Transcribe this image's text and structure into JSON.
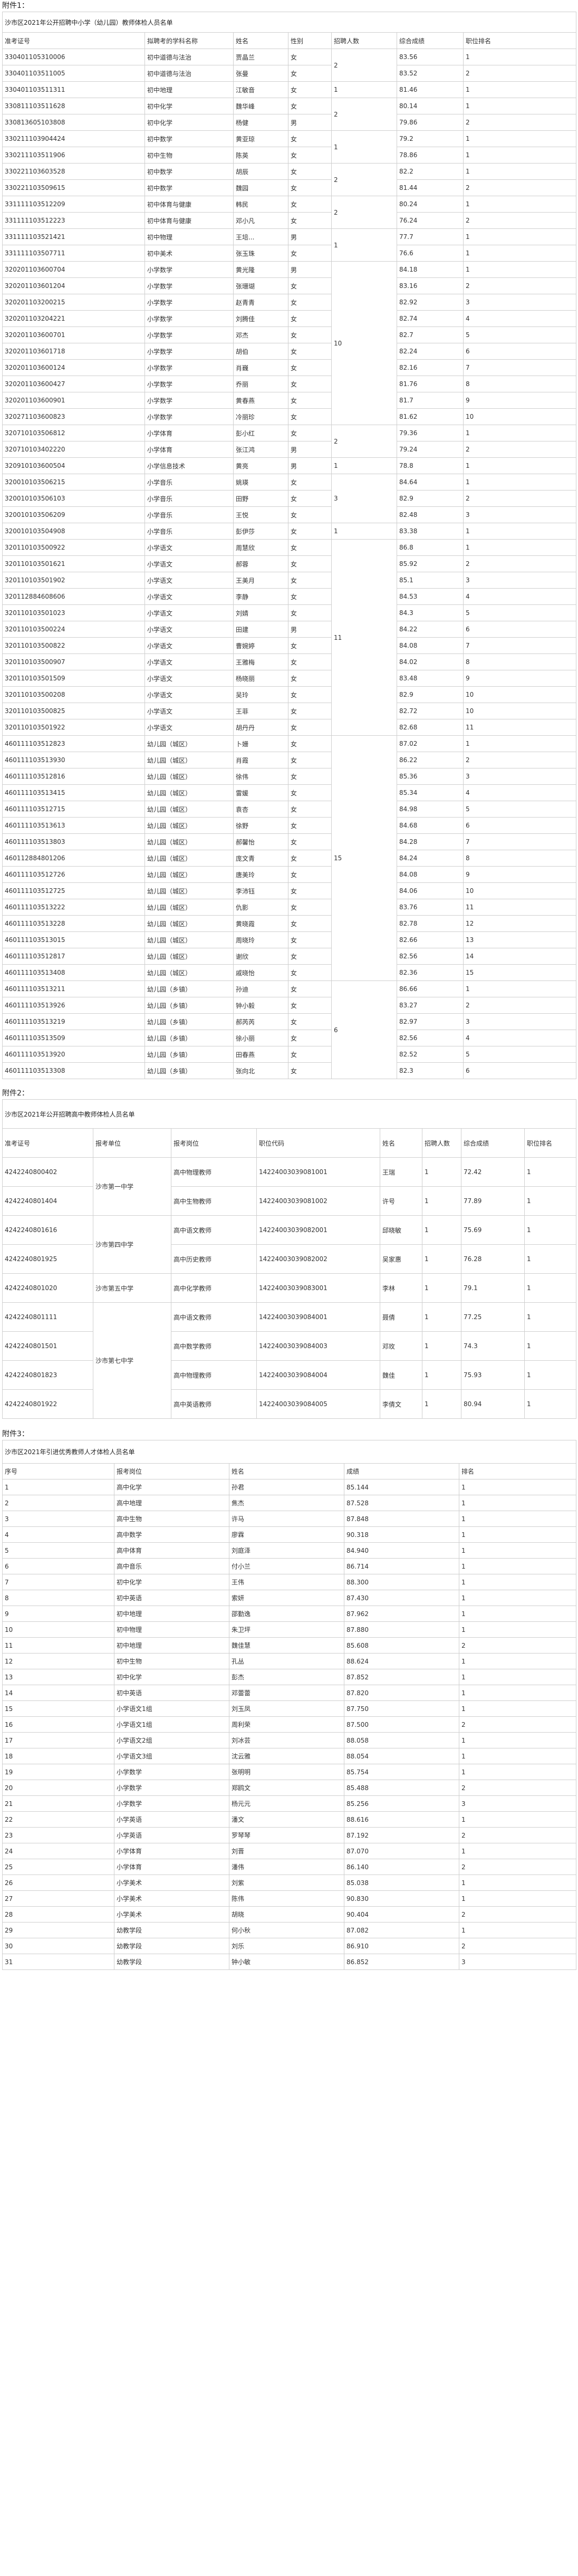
{
  "attachment1": {
    "label": "附件1：",
    "title": "沙市区2021年公开招聘中小学（幼儿园）教师体检人员名单",
    "headers": [
      "准考证号",
      "拟聘考的学科名称",
      "姓名",
      "性别",
      "招聘人数",
      "综合成绩",
      "职位排名"
    ],
    "rows": [
      [
        "330401105310006",
        "初中道德与法治",
        "贾晶兰",
        "女",
        "",
        "83.56",
        "1"
      ],
      [
        "330401103511005",
        "初中道德与法治",
        "张曼",
        "女",
        "",
        "83.52",
        "2"
      ],
      [
        "330401103511311",
        "初中地理",
        "江敏音",
        "女",
        "",
        "81.46",
        "1"
      ],
      [
        "330811103511628",
        "初中化学",
        "魏华峰",
        "女",
        "",
        "80.14",
        "1"
      ],
      [
        "330813605103808",
        "初中化学",
        "杨健",
        "男",
        "",
        "79.86",
        "2"
      ],
      [
        "330211103904424",
        "初中数学",
        "黄亚琼",
        "女",
        "",
        "79.2",
        "1"
      ],
      [
        "330211103511906",
        "初中生物",
        "陈英",
        "女",
        "",
        "78.86",
        "1"
      ],
      [
        "330221103603528",
        "初中数学",
        "胡辰",
        "女",
        "",
        "82.2",
        "1"
      ],
      [
        "330221103509615",
        "初中数学",
        "魏园",
        "女",
        "",
        "81.44",
        "2"
      ],
      [
        "331111103512209",
        "初中体育与健康",
        "韩民",
        "女",
        "",
        "80.24",
        "1"
      ],
      [
        "331111103512223",
        "初中体育与健康",
        "邓小凡",
        "女",
        "",
        "76.24",
        "2"
      ],
      [
        "331111103521421",
        "初中物理",
        "王培...",
        "男",
        "",
        "77.7",
        "1"
      ],
      [
        "331111103507711",
        "初中美术",
        "张玉珠",
        "女",
        "",
        "76.6",
        "1"
      ],
      [
        "320201103600704",
        "小学数学",
        "黄光隆",
        "男",
        "",
        "84.18",
        "1"
      ],
      [
        "320201103601204",
        "小学数学",
        "张珊瑚",
        "女",
        "",
        "83.16",
        "2"
      ],
      [
        "320201103200215",
        "小学数学",
        "赵青青",
        "女",
        "",
        "82.92",
        "3"
      ],
      [
        "320201103204221",
        "小学数学",
        "刘腾佳",
        "女",
        "",
        "82.74",
        "4"
      ],
      [
        "320201103600701",
        "小学数学",
        "邓杰",
        "女",
        "",
        "82.7",
        "5"
      ],
      [
        "320201103601718",
        "小学数学",
        "胡伯",
        "女",
        "",
        "82.24",
        "6"
      ],
      [
        "320201103600124",
        "小学数学",
        "肖巍",
        "女",
        "",
        "82.16",
        "7"
      ],
      [
        "320201103600427",
        "小学数学",
        "乔丽",
        "女",
        "",
        "81.76",
        "8"
      ],
      [
        "320201103600901",
        "小学数学",
        "黄春燕",
        "女",
        "",
        "81.7",
        "9"
      ],
      [
        "320271103600823",
        "小学数学",
        "冷丽珍",
        "女",
        "",
        "81.62",
        "10"
      ],
      [
        "320710103506812",
        "小学体育",
        "彭小红",
        "女",
        "",
        "79.36",
        "1"
      ],
      [
        "320710103402220",
        "小学体育",
        "张江鸿",
        "男",
        "",
        "79.24",
        "2"
      ],
      [
        "320910103600504",
        "小学信息技术",
        "黄亮",
        "男",
        "",
        "78.8",
        "1"
      ],
      [
        "320010103506215",
        "小学音乐",
        "姚瑛",
        "女",
        "",
        "84.64",
        "1"
      ],
      [
        "320010103506103",
        "小学音乐",
        "田野",
        "女",
        "",
        "82.9",
        "2"
      ],
      [
        "320010103506209",
        "小学音乐",
        "王悦",
        "女",
        "",
        "82.48",
        "3"
      ],
      [
        "320010103504908",
        "小学音乐",
        "彭伊莎",
        "女",
        "",
        "83.38",
        "1"
      ],
      [
        "320110103500922",
        "小学语文",
        "周慧欣",
        "女",
        "",
        "86.8",
        "1"
      ],
      [
        "320110103501621",
        "小学语文",
        "郝蓉",
        "女",
        "",
        "85.92",
        "2"
      ],
      [
        "320110103501902",
        "小学语文",
        "王美月",
        "女",
        "",
        "85.1",
        "3"
      ],
      [
        "320112884608606",
        "小学语文",
        "李静",
        "女",
        "",
        "84.53",
        "4"
      ],
      [
        "320110103501023",
        "小学语文",
        "刘婧",
        "女",
        "",
        "84.3",
        "5"
      ],
      [
        "320110103500224",
        "小学语文",
        "田建",
        "男",
        "",
        "84.22",
        "6"
      ],
      [
        "320110103500822",
        "小学语文",
        "曹婉婷",
        "女",
        "",
        "84.08",
        "7"
      ],
      [
        "320110103500907",
        "小学语文",
        "王雅梅",
        "女",
        "",
        "84.02",
        "8"
      ],
      [
        "320110103501509",
        "小学语文",
        "杨晓丽",
        "女",
        "",
        "83.48",
        "9"
      ],
      [
        "320110103500208",
        "小学语文",
        "吴玲",
        "女",
        "",
        "82.9",
        "10"
      ],
      [
        "320110103500825",
        "小学语文",
        "王菲",
        "女",
        "",
        "82.72",
        "10"
      ],
      [
        "320110103501922",
        "小学语文",
        "胡丹丹",
        "女",
        "",
        "82.68",
        "11"
      ],
      [
        "460111103512823",
        "幼儿园（城区）",
        "卜姗",
        "女",
        "",
        "87.02",
        "1"
      ],
      [
        "460111103513930",
        "幼儿园（城区）",
        "肖霞",
        "女",
        "",
        "86.22",
        "2"
      ],
      [
        "460111103512816",
        "幼儿园（城区）",
        "徐伟",
        "女",
        "",
        "85.36",
        "3"
      ],
      [
        "460111103513415",
        "幼儿园（城区）",
        "雷媛",
        "女",
        "",
        "85.34",
        "4"
      ],
      [
        "460111103512715",
        "幼儿园（城区）",
        "袁杏",
        "女",
        "",
        "84.98",
        "5"
      ],
      [
        "460111103513613",
        "幼儿园（城区）",
        "徐野",
        "女",
        "",
        "84.68",
        "6"
      ],
      [
        "460111103513803",
        "幼儿园（城区）",
        "郝馨怡",
        "女",
        "",
        "84.28",
        "7"
      ],
      [
        "460112884801206",
        "幼儿园（城区）",
        "庞文青",
        "女",
        "",
        "84.24",
        "8"
      ],
      [
        "460111103512726",
        "幼儿园（城区）",
        "唐美玲",
        "女",
        "",
        "84.08",
        "9"
      ],
      [
        "460111103512725",
        "幼儿园（城区）",
        "李沛钰",
        "女",
        "",
        "84.06",
        "10"
      ],
      [
        "460111103513222",
        "幼儿园（城区）",
        "仇影",
        "女",
        "",
        "83.76",
        "11"
      ],
      [
        "460111103513228",
        "幼儿园（城区）",
        "黄晓霞",
        "女",
        "",
        "82.78",
        "12"
      ],
      [
        "460111103513015",
        "幼儿园（城区）",
        "周晓玲",
        "女",
        "",
        "82.66",
        "13"
      ],
      [
        "460111103512817",
        "幼儿园（城区）",
        "谢欣",
        "女",
        "",
        "82.56",
        "14"
      ],
      [
        "460111103513408",
        "幼儿园（城区）",
        "戚晓怡",
        "女",
        "",
        "82.36",
        "15"
      ],
      [
        "460111103513211",
        "幼儿园（乡镇）",
        "孙迪",
        "女",
        "",
        "86.66",
        "1"
      ],
      [
        "460111103513926",
        "幼儿园（乡镇）",
        "钟小毅",
        "女",
        "",
        "83.27",
        "2"
      ],
      [
        "460111103513219",
        "幼儿园（乡镇）",
        "郝芮芮",
        "女",
        "",
        "82.97",
        "3"
      ],
      [
        "460111103513509",
        "幼儿园（乡镇）",
        "徐小丽",
        "女",
        "",
        "82.56",
        "4"
      ],
      [
        "460111103513920",
        "幼儿园（乡镇）",
        "田春燕",
        "女",
        "",
        "82.52",
        "5"
      ],
      [
        "460111103513308",
        "幼儿园（乡镇）",
        "张向北",
        "女",
        "",
        "82.3",
        "6"
      ]
    ],
    "quota_groups": [
      {
        "start": 0,
        "span": 2,
        "value": "2"
      },
      {
        "start": 2,
        "span": 1,
        "value": "1"
      },
      {
        "start": 3,
        "span": 2,
        "value": "2"
      },
      {
        "start": 5,
        "span": 2,
        "value": "1"
      },
      {
        "start": 7,
        "span": 2,
        "value": "2"
      },
      {
        "start": 9,
        "span": 2,
        "value": "2"
      },
      {
        "start": 11,
        "span": 2,
        "value": "1"
      },
      {
        "start": 13,
        "span": 10,
        "value": "10"
      },
      {
        "start": 23,
        "span": 2,
        "value": "2"
      },
      {
        "start": 25,
        "span": 1,
        "value": "1"
      },
      {
        "start": 26,
        "span": 3,
        "value": "3"
      },
      {
        "start": 29,
        "span": 1,
        "value": "1"
      },
      {
        "start": 30,
        "span": 12,
        "value": "11"
      },
      {
        "start": 42,
        "span": 15,
        "value": "15"
      },
      {
        "start": 57,
        "span": 6,
        "value": "6"
      }
    ]
  },
  "attachment2": {
    "label": "附件2：",
    "title": "沙市区2021年公开招聘高中教师体检人员名单",
    "headers": [
      "准考证号",
      "报考单位",
      "报考岗位",
      "职位代码",
      "姓名",
      "招聘人数",
      "综合成绩",
      "职位排名"
    ],
    "rows": [
      [
        "4242240800402",
        "",
        "高中物理教师",
        "14224003039081001",
        "王瑞",
        "1",
        "72.42",
        "1"
      ],
      [
        "4242240801404",
        "",
        "高中生物教师",
        "14224003039081002",
        "许号",
        "1",
        "77.89",
        "1"
      ],
      [
        "4242240801616",
        "",
        "高中语文教师",
        "14224003039082001",
        "邱晓敏",
        "1",
        "75.69",
        "1"
      ],
      [
        "4242240801925",
        "",
        "高中历史教师",
        "14224003039082002",
        "吴家惠",
        "1",
        "76.28",
        "1"
      ],
      [
        "4242240801020",
        "",
        "高中化学教师",
        "14224003039083001",
        "李林",
        "1",
        "79.1",
        "1"
      ],
      [
        "4242240801111",
        "",
        "高中语文教师",
        "14224003039084001",
        "聂倩",
        "1",
        "77.25",
        "1"
      ],
      [
        "4242240801501",
        "",
        "高中数学教师",
        "14224003039084003",
        "邓玫",
        "1",
        "74.3",
        "1"
      ],
      [
        "4242240801823",
        "",
        "高中物理教师",
        "14224003039084004",
        "魏佳",
        "1",
        "75.93",
        "1"
      ],
      [
        "4242240801922",
        "",
        "高中英语教师",
        "14224003039084005",
        "李倩文",
        "1",
        "80.94",
        "1"
      ]
    ],
    "unit_groups": [
      {
        "start": 0,
        "span": 2,
        "value": "沙市第一中学"
      },
      {
        "start": 2,
        "span": 2,
        "value": "沙市第四中学"
      },
      {
        "start": 4,
        "span": 1,
        "value": "沙市第五中学"
      },
      {
        "start": 5,
        "span": 4,
        "value": "沙市第七中学"
      }
    ]
  },
  "attachment3": {
    "label": "附件3：",
    "title": "沙市区2021年引进优秀教师人才体检人员名单",
    "headers": [
      "序号",
      "报考岗位",
      "姓名",
      "成绩",
      "排名"
    ],
    "rows": [
      [
        "1",
        "高中化学",
        "孙君",
        "85.144",
        "1"
      ],
      [
        "2",
        "高中地理",
        "焦杰",
        "87.528",
        "1"
      ],
      [
        "3",
        "高中生物",
        "许马",
        "87.848",
        "1"
      ],
      [
        "4",
        "高中数学",
        "廖霖",
        "90.318",
        "1"
      ],
      [
        "5",
        "高中体育",
        "刘庭泽",
        "84.940",
        "1"
      ],
      [
        "6",
        "高中音乐",
        "付小兰",
        "86.714",
        "1"
      ],
      [
        "7",
        "初中化学",
        "王伟",
        "88.300",
        "1"
      ],
      [
        "8",
        "初中英语",
        "索妍",
        "87.430",
        "1"
      ],
      [
        "9",
        "初中地理",
        "邵勤逸",
        "87.962",
        "1"
      ],
      [
        "10",
        "初中物理",
        "朱卫坪",
        "87.880",
        "1"
      ],
      [
        "11",
        "初中地理",
        "魏佳慧",
        "85.608",
        "2"
      ],
      [
        "12",
        "初中生物",
        "孔丛",
        "88.624",
        "1"
      ],
      [
        "13",
        "初中化学",
        "彭杰",
        "87.852",
        "1"
      ],
      [
        "14",
        "初中英语",
        "邓蕾蕾",
        "87.820",
        "1"
      ],
      [
        "15",
        "小学语文1组",
        "刘玉凤",
        "87.750",
        "1"
      ],
      [
        "16",
        "小学语文1组",
        "周利荣",
        "87.500",
        "2"
      ],
      [
        "17",
        "小学语文2组",
        "刘冰芸",
        "88.058",
        "1"
      ],
      [
        "18",
        "小学语文3组",
        "沈云雅",
        "88.054",
        "1"
      ],
      [
        "19",
        "小学数学",
        "张明明",
        "85.754",
        "1"
      ],
      [
        "20",
        "小学数学",
        "郑鸥文",
        "85.488",
        "2"
      ],
      [
        "21",
        "小学数学",
        "杨元元",
        "85.256",
        "3"
      ],
      [
        "22",
        "小学英语",
        "潘文",
        "88.616",
        "1"
      ],
      [
        "23",
        "小学英语",
        "罗琴琴",
        "87.192",
        "2"
      ],
      [
        "24",
        "小学体育",
        "刘晋",
        "87.070",
        "1"
      ],
      [
        "25",
        "小学体育",
        "潘伟",
        "86.140",
        "2"
      ],
      [
        "26",
        "小学美术",
        "刘紫",
        "85.038",
        "1"
      ],
      [
        "27",
        "小学美术",
        "陈伟",
        "90.830",
        "1"
      ],
      [
        "28",
        "小学美术",
        "胡晓",
        "90.404",
        "2"
      ],
      [
        "29",
        "幼教学段",
        "何小秋",
        "87.082",
        "1"
      ],
      [
        "30",
        "幼教学段",
        "刘乐",
        "86.910",
        "2"
      ],
      [
        "31",
        "幼教学段",
        "钟小敏",
        "86.852",
        "3"
      ]
    ]
  }
}
